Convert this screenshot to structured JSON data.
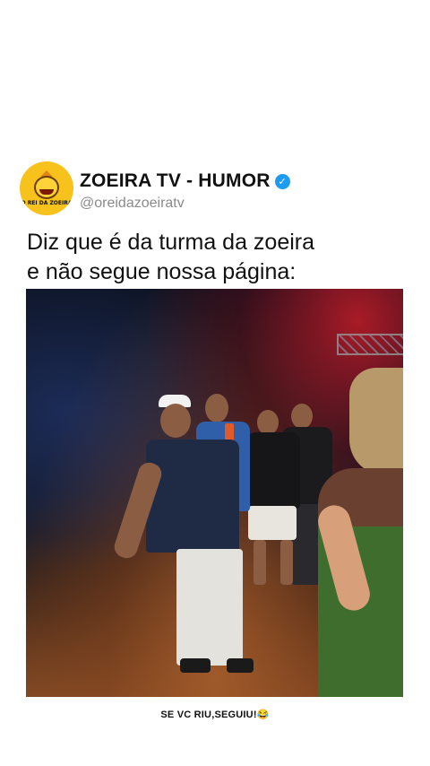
{
  "post": {
    "account_name": "ZOEIRA TV - HUMOR",
    "handle": "@oreidazoeiratv",
    "avatar_text": "O REI DA ZOEIRA",
    "verified_color": "#1d9bf0",
    "caption_line1": "Diz que é da turma da zoeira",
    "caption_line2": "e não segue nossa página:"
  },
  "video": {
    "description_icon": "video-frame"
  },
  "footer": {
    "text": "SE VC RIU,SEGUIU!😂"
  }
}
